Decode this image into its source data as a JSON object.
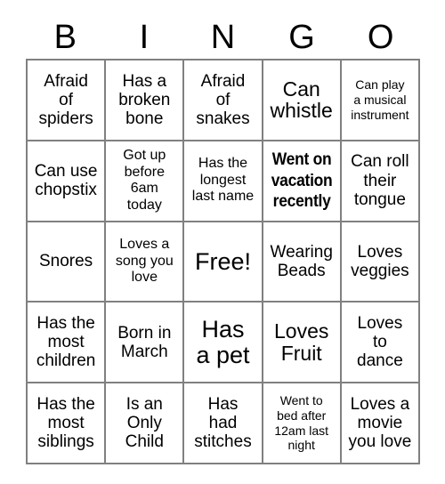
{
  "title": "BINGO",
  "header": {
    "letters": [
      "B",
      "I",
      "N",
      "G",
      "O"
    ]
  },
  "colors": {
    "text": "#000000",
    "grid_line": "#808080",
    "background": "#ffffff"
  },
  "grid": {
    "columns": 5,
    "rows": 5,
    "free_space": {
      "row": 3,
      "column": 3,
      "label": "Free!"
    },
    "cells": [
      {
        "id": "b1",
        "text": "Afraid\nof\nspiders",
        "size": "t-md",
        "style": "normal"
      },
      {
        "id": "i1",
        "text": "Has a\nbroken\nbone",
        "size": "t-md",
        "style": "normal"
      },
      {
        "id": "n1",
        "text": "Afraid\nof\nsnakes",
        "size": "t-md",
        "style": "normal"
      },
      {
        "id": "g1",
        "text": "Can\nwhistle",
        "size": "t-lg",
        "style": "normal"
      },
      {
        "id": "o1",
        "text": "Can play\na musical\ninstrument",
        "size": "t-xs",
        "style": "normal"
      },
      {
        "id": "b2",
        "text": "Can use\nchopstix",
        "size": "t-md",
        "style": "normal"
      },
      {
        "id": "i2",
        "text": "Got up\nbefore\n6am\ntoday",
        "size": "t-sm",
        "style": "normal"
      },
      {
        "id": "n2",
        "text": "Has the\nlongest\nlast name",
        "size": "t-sm",
        "style": "normal"
      },
      {
        "id": "g2",
        "text": "Went on\nvacation\nrecently",
        "size": "t-bold-cond",
        "style": "bold-condensed"
      },
      {
        "id": "o2",
        "text": "Can roll\ntheir\ntongue",
        "size": "t-md",
        "style": "normal"
      },
      {
        "id": "b3",
        "text": "Snores",
        "size": "t-md",
        "style": "normal"
      },
      {
        "id": "i3",
        "text": "Loves a\nsong you\nlove",
        "size": "t-sm",
        "style": "normal"
      },
      {
        "id": "n3",
        "text": "Free!",
        "size": "t-xl",
        "style": "normal"
      },
      {
        "id": "g3",
        "text": "Wearing\nBeads",
        "size": "t-md",
        "style": "normal"
      },
      {
        "id": "o3",
        "text": "Loves\nveggies",
        "size": "t-md",
        "style": "normal"
      },
      {
        "id": "b4",
        "text": "Has the\nmost\nchildren",
        "size": "t-md",
        "style": "normal"
      },
      {
        "id": "i4",
        "text": "Born in\nMarch",
        "size": "t-md",
        "style": "normal"
      },
      {
        "id": "n4",
        "text": "Has\na pet",
        "size": "t-xl",
        "style": "normal"
      },
      {
        "id": "g4",
        "text": "Loves\nFruit",
        "size": "t-lg",
        "style": "normal"
      },
      {
        "id": "o4",
        "text": "Loves\nto\ndance",
        "size": "t-md",
        "style": "normal"
      },
      {
        "id": "b5",
        "text": "Has the\nmost\nsiblings",
        "size": "t-md",
        "style": "normal"
      },
      {
        "id": "i5",
        "text": "Is an\nOnly\nChild",
        "size": "t-md",
        "style": "normal"
      },
      {
        "id": "n5",
        "text": "Has\nhad\nstitches",
        "size": "t-md",
        "style": "normal"
      },
      {
        "id": "g5",
        "text": "Went to\nbed after\n12am last\nnight",
        "size": "t-xs",
        "style": "normal"
      },
      {
        "id": "o5",
        "text": "Loves a\nmovie\nyou love",
        "size": "t-md",
        "style": "normal"
      }
    ]
  }
}
